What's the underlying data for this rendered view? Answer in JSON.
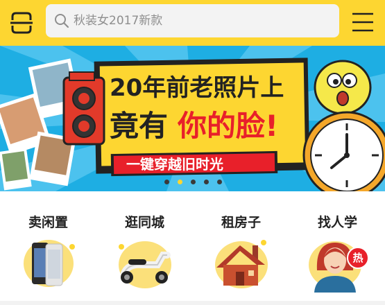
{
  "search": {
    "placeholder": "秋装女2017新款"
  },
  "banner": {
    "headline_line1": "20年前老照片上",
    "headline_line2a": "竟有",
    "headline_line2b": "你的脸!",
    "ribbon": "一键穿越旧时光",
    "slide_count": 5,
    "active_slide": 2
  },
  "categories": [
    {
      "label": "卖闲置"
    },
    {
      "label": "逛同城"
    },
    {
      "label": "租房子"
    },
    {
      "label": "找人学",
      "badge": "热"
    }
  ],
  "colors": {
    "brand_yellow": "#fdd631",
    "banner_blue": "#1eaee3",
    "accent_red": "#e8202a"
  }
}
